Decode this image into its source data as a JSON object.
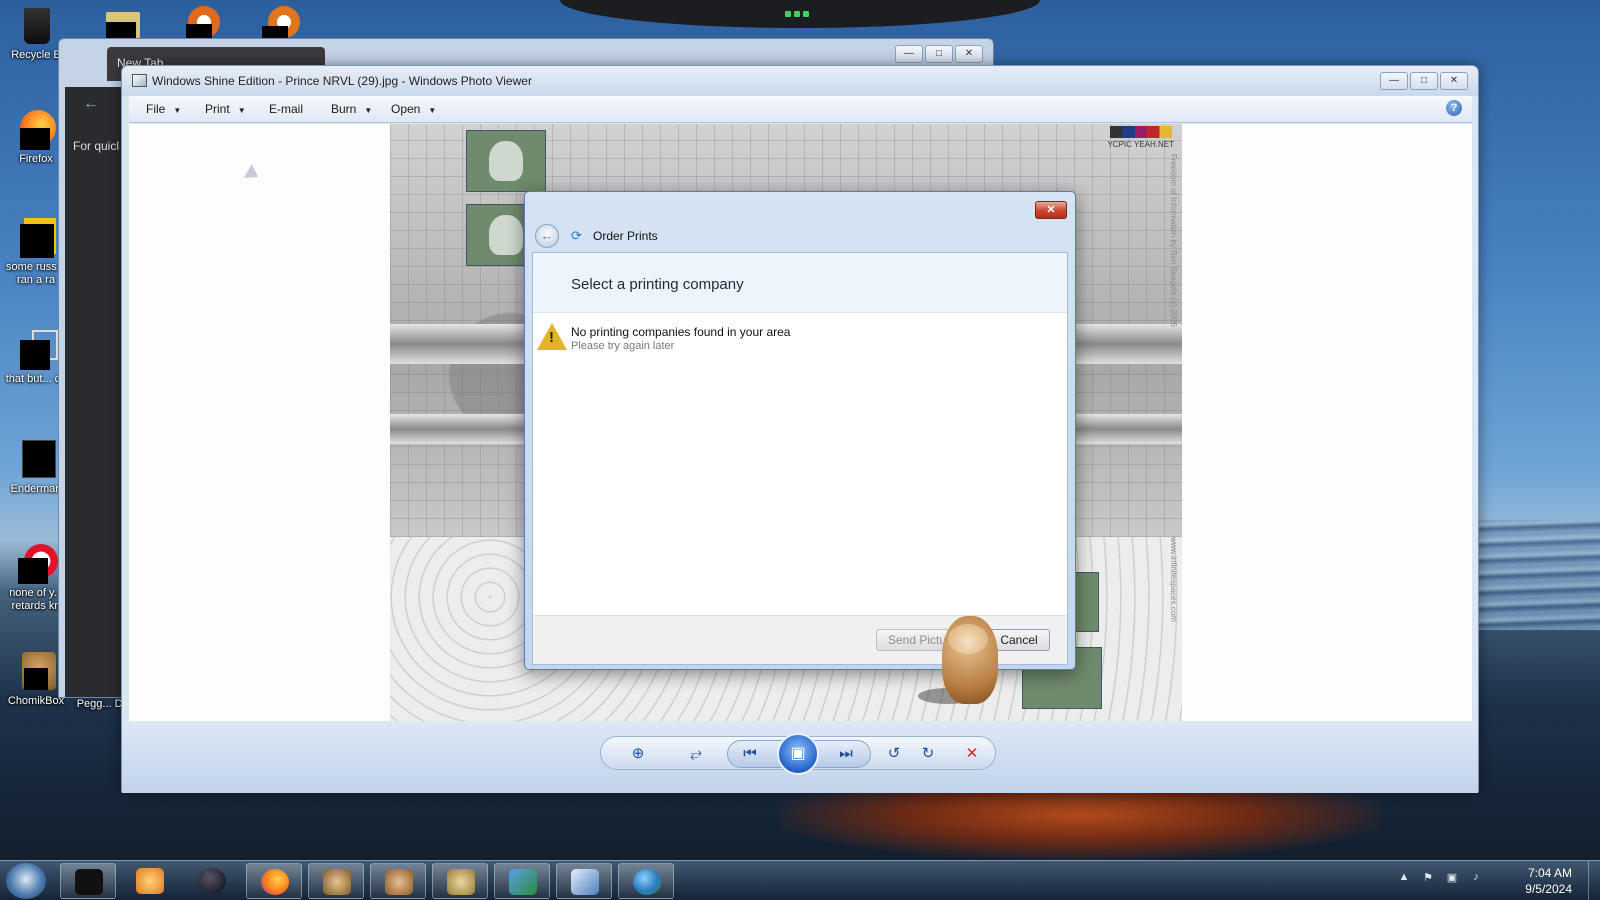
{
  "desktop": {
    "icons": [
      {
        "label": "Recycle B"
      },
      {
        "label": "Firefox"
      },
      {
        "label": "some russ... ran a ra"
      },
      {
        "label": "that but... c#"
      },
      {
        "label": "Enderman"
      },
      {
        "label": "none of y... retards kn"
      },
      {
        "label": "ChomikBox"
      },
      {
        "label": "Pegg... Delu"
      }
    ]
  },
  "background_window": {
    "tab_label": "New Tab",
    "sidebar_text": "For quicl"
  },
  "viewer": {
    "title": "Windows Shine Edition - Prince NRVL (29).jpg - Windows Photo Viewer",
    "menu": [
      {
        "label": "File",
        "has_dropdown": true
      },
      {
        "label": "Print",
        "has_dropdown": true
      },
      {
        "label": "E-mail",
        "has_dropdown": false
      },
      {
        "label": "Burn",
        "has_dropdown": true
      },
      {
        "label": "Open",
        "has_dropdown": true
      }
    ],
    "help_symbol": "?",
    "photo": {
      "brand_text": "YCPIC YEAH.NET",
      "vertical_text": "Freedom of Information by Ben Seagels (c) 2006",
      "vertical_text_2": "www.infinitespaces.com"
    },
    "toolbar": {
      "zoom_icon": "zoom-icon",
      "fit_icon": "actual-size-icon",
      "prev_icon": "previous-icon",
      "slideshow_icon": "slideshow-icon",
      "next_icon": "next-icon",
      "rotate_ccw_icon": "rotate-counterclockwise-icon",
      "rotate_cw_icon": "rotate-clockwise-icon",
      "delete_icon": "delete-icon"
    }
  },
  "dialog": {
    "window_title": "Order Prints",
    "heading": "Select a printing company",
    "message": "No printing companies found in your area",
    "submessage": "Please try again later",
    "send_button": "Send Pictu",
    "cancel_button": "Cancel"
  },
  "taskbar": {
    "clock_time": "7:04 AM",
    "clock_date": "9/5/2024"
  },
  "colors": {
    "accent_blue": "#2462c8",
    "warning_yellow": "#e2b323",
    "close_red": "#c7462b"
  }
}
